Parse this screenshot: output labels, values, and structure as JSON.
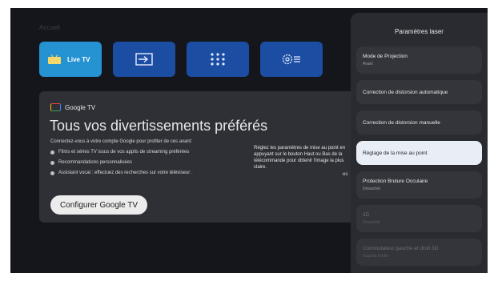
{
  "home": {
    "label": "Accueil",
    "tiles": [
      {
        "label": "Live TV",
        "icon": "tv-icon"
      },
      {
        "icon": "input-icon"
      },
      {
        "icon": "apps-grid-icon"
      },
      {
        "icon": "settings-icon"
      }
    ]
  },
  "card": {
    "brand": "Google TV",
    "title": "Tous vos divertissements préférés",
    "subtitle": "Connectez-vous à votre compte Google pour profiter de ces avant:",
    "bullets": [
      "Films et séries TV issus de vos applis de streaming préférées",
      "Recommandations personnalisées",
      "Assistant vocal : effectuez des recherches sur votre téléviseur ."
    ],
    "button": "Configurer Google TV",
    "tail": "es"
  },
  "tooltip": "Réglez les paramètres de mise au point en appuyant sur le bouton Haut ou Bas de la télécommande pour obtenir l'image la plus claire.",
  "panel": {
    "title": "Paramètres laser",
    "options": [
      {
        "label": "Mode de Projection",
        "value": "Avant"
      },
      {
        "label": "Correction de distorsion automatique",
        "value": ""
      },
      {
        "label": "Correction de distorsion manuelle",
        "value": ""
      },
      {
        "label": "Réglage de la mise au point",
        "value": ""
      },
      {
        "label": "Protection Brulure Occulaire",
        "value": "Désactivé"
      },
      {
        "label": "3D",
        "value": "Désactivé"
      },
      {
        "label": "Commutateur gauche et droit 3D",
        "value": "Gauche Droite"
      }
    ]
  }
}
